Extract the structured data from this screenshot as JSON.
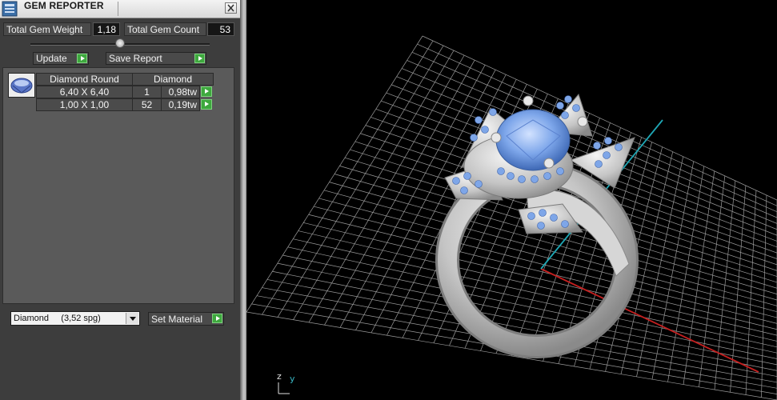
{
  "window": {
    "title": "GEM REPORTER"
  },
  "stats": {
    "total_weight_label": "Total Gem Weight",
    "total_weight_value": "1,18",
    "total_count_label": "Total Gem Count",
    "total_count_value": "53"
  },
  "buttons": {
    "update": "Update",
    "save_report": "Save Report",
    "set_material": "Set Material"
  },
  "gem_table": {
    "headers": [
      "Diamond Round",
      "Diamond"
    ],
    "rows": [
      {
        "size": "6,40 X 6,40",
        "count": "1",
        "weight": "0,98tw"
      },
      {
        "size": "1,00 X 1,00",
        "count": "52",
        "weight": "0,19tw"
      }
    ]
  },
  "material": {
    "selected": "Diamond     (3,52 spg)"
  },
  "viewport": {
    "axis_z": "z",
    "axis_y": "y"
  },
  "colors": {
    "panel": "#3d3d3d",
    "accent_green": "#3ea83e",
    "grid": "#9b9b9b",
    "axis_red": "#c41f1f",
    "axis_cyan": "#1fa7b5",
    "gem_blue": "#6f9be0",
    "metal": "#c8c8c8"
  },
  "icons": [
    "gem-reporter-app-icon",
    "close-icon",
    "round-diamond-icon",
    "play-arrow-icon",
    "chevron-down-icon",
    "slider-handle"
  ]
}
